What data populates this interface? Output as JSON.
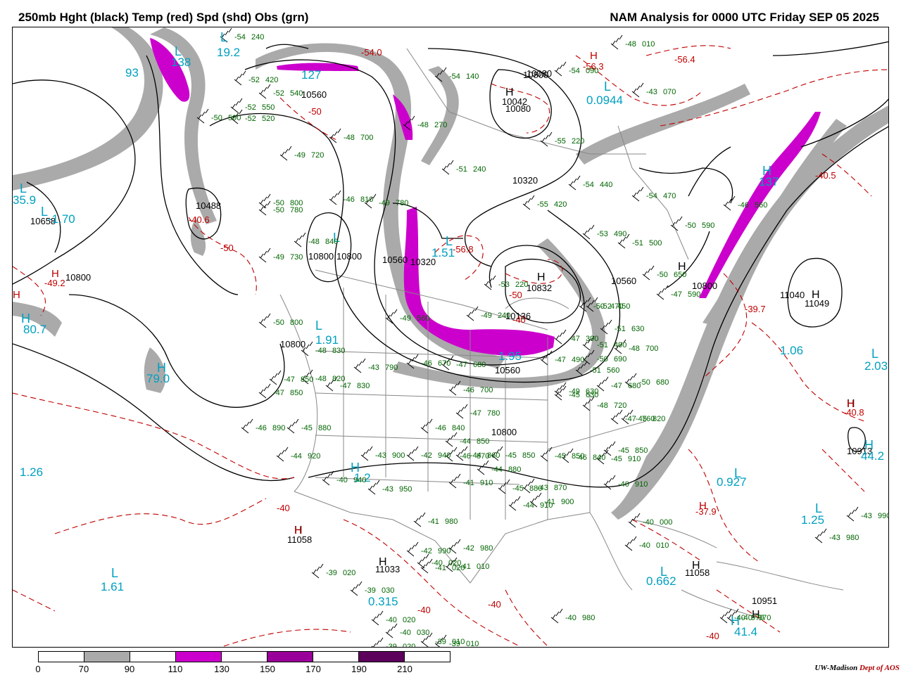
{
  "title_left": "250mb Hght (black) Temp (red) Spd (shd) Obs (grn)",
  "title_right": "NAM Analysis for 0000 UTC Friday  SEP 05 2025",
  "credit_org": "UW-Madison",
  "credit_dept": "Dept of AOS",
  "colors": {
    "height_contour": "#000000",
    "temp_contour": "#c00000",
    "obs": "#006400",
    "pressure_center": "#00a0c0",
    "speed_70_90": "#aaaaaa",
    "speed_110_130": "#cc00cc",
    "speed_130_150": "#990099",
    "borders": "#888888"
  },
  "legend": {
    "ticks": [
      "0",
      "70",
      "90",
      "110",
      "130",
      "150",
      "170",
      "190",
      "210"
    ],
    "segment_colors": [
      "#ffffff",
      "#aaaaaa",
      "#ffffff",
      "#cc00cc",
      "#ffffff",
      "#990099",
      "#ffffff",
      "#5c005c",
      "#ffffff"
    ]
  },
  "height_labels": [
    "10560",
    "10800",
    "10320",
    "10080",
    "10042",
    "10800",
    "11040",
    "11049",
    "10560",
    "10800",
    "10832",
    "10560",
    "11058",
    "11033",
    "10913",
    "11058",
    "10951",
    "10658",
    "10800",
    "10488",
    "10320",
    "10560",
    "10136",
    "10800",
    "10800",
    "10800",
    "10080"
  ],
  "temp_labels": [
    "-54.0",
    "-50",
    "-40",
    "-49.2",
    "-40.6",
    "-50",
    "-56.8",
    "-50",
    "-40",
    "-39.7",
    "-40.5",
    "-40.8",
    "-37.9",
    "-40",
    "-40",
    "-40",
    "-56.3",
    "-56.4"
  ],
  "center_values": [
    "19.2",
    "138",
    "127",
    "0.0944",
    "35.9",
    "-1.70",
    "1.51",
    "1.91",
    "80.7",
    "79.0",
    "1.26",
    "1.61",
    "1.2",
    "0.315",
    "0.927",
    "1.25",
    "0.662",
    "41.4",
    "1.06",
    "2.03",
    "44.2",
    "137",
    "93",
    "1.95"
  ],
  "station_obs": [
    "-54 240",
    "-52 420",
    "-52 540",
    "-52 550",
    "-50 590",
    "-52 520",
    "-48 700",
    "-54 140",
    "-54 090",
    "-48 010",
    "-43 070",
    "-51 240",
    "-55 220",
    "-54 440",
    "-54 470",
    "-55 420",
    "-53 490",
    "-51 500",
    "-50 650",
    "-47 590",
    "-52 450",
    "-50 590",
    "-46 560",
    "-50 690",
    "-47 680",
    "-50 800",
    "-49 720",
    "-50 780",
    "-49 730",
    "-48 840",
    "-46 810",
    "-49 780",
    "-48 270",
    "-49 560",
    "-53 220",
    "-49 240",
    "-50 800",
    "-48 830",
    "-48 820",
    "-47 830",
    "-47 850",
    "-47 850",
    "-43 790",
    "-46 670",
    "-47 680",
    "-46 700",
    "-47 780",
    "-46 840",
    "-44 850",
    "-44 860",
    "-45 850",
    "-46 870",
    "-44 880",
    "-41 910",
    "-43 870",
    "-45 880",
    "-45 850",
    "-41 900",
    "-44 910",
    "-41 980",
    "-39 020",
    "-39 030",
    "-40 020",
    "-40 030",
    "-39 020",
    "-39 010",
    "-40 000",
    "-40 010",
    "-40 970",
    "-45 910",
    "-45 850",
    "-46 840",
    "-45 820",
    "-47 760",
    "-48 720",
    "-49 630",
    "-51 560",
    "-47 490",
    "-47 390",
    "-50 470",
    "-51 490",
    "-48 700",
    "-51 630",
    "-50 680",
    "-45 630",
    "-43 900",
    "-42 940",
    "-40 940",
    "-43 950",
    "-44 920",
    "-46 890",
    "-45 880",
    "-42 990",
    "-43 990",
    "-43 980",
    "-40 970",
    "-40 980",
    "-40 020",
    "-41 020",
    "-41 010",
    "-42 980",
    "-39 010",
    "-40 910"
  ]
}
